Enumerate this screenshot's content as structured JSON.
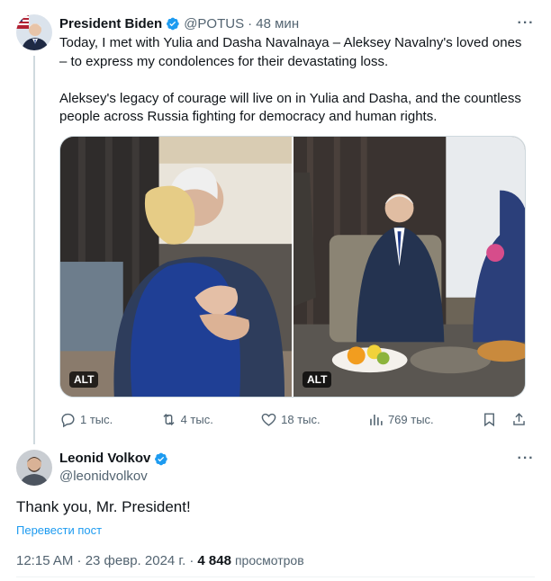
{
  "parent_tweet": {
    "author_name": "President Biden",
    "author_handle": "@POTUS",
    "time_ago": "· 48 мин",
    "text": "Today, I met with Yulia and Dasha Navalnaya – Aleksey Navalny's loved ones – to express my condolences for their devastating loss.\n\nAleksey's legacy of courage will live on in Yulia and Dasha, and the countless people across Russia fighting for democracy and human rights.",
    "media": [
      {
        "alt_badge": "ALT"
      },
      {
        "alt_badge": "ALT"
      }
    ],
    "actions": {
      "replies": "1 тыс.",
      "reposts": "4 тыс.",
      "likes": "18 тыс.",
      "views": "769 тыс."
    },
    "verified_color": "#1d9bf0"
  },
  "reply_tweet": {
    "author_name": "Leonid Volkov",
    "author_handle": "@leonidvolkov",
    "text": "Thank you, Mr. President!",
    "translate_label": "Перевести пост",
    "timestamp": "12:15 AM · 23 февр. 2024 г. ·",
    "views_count": "4 848",
    "views_label": "просмотров"
  },
  "icons": [
    "more-icon",
    "verified-icon",
    "reply-icon",
    "repost-icon",
    "like-icon",
    "views-icon",
    "bookmark-icon",
    "share-icon"
  ],
  "colors": {
    "text": "#0f1419",
    "secondary": "#536471",
    "accent": "#1d9bf0",
    "border": "#cfd9de"
  }
}
